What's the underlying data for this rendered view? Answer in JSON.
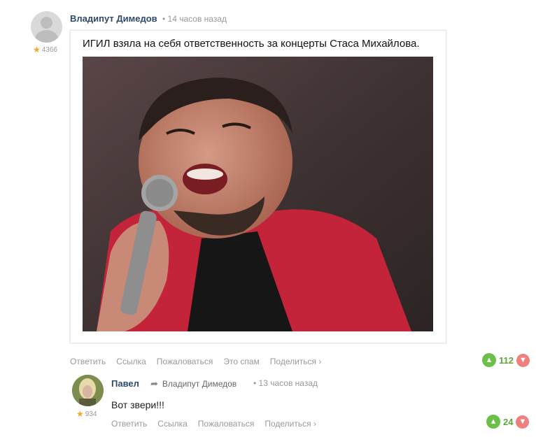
{
  "post": {
    "author": "Владипут Димедов",
    "time": "• 14 часов назад",
    "rating": "4366",
    "caption": "ИГИЛ взяла на себя ответственность за концерты Стаса Михайлова.",
    "actions": [
      "Ответить",
      "Ссылка",
      "Пожаловаться",
      "Это спам",
      "Поделиться ›"
    ],
    "likes": "112"
  },
  "reply": {
    "author": "Павел",
    "reply_to": "Владипут Димедов",
    "time": "• 13 часов назад",
    "rating": "934",
    "text": "Вот звери!!!",
    "actions": [
      "Ответить",
      "Ссылка",
      "Пожаловаться",
      "Поделиться ›"
    ],
    "likes": "24"
  },
  "icons": {
    "star": "star-icon",
    "like": "thumb-up-icon",
    "dislike": "thumb-down-icon",
    "reply_arrow": "reply-arrow-icon"
  },
  "colors": {
    "author": "#2e4a6b",
    "like": "#6cc04a",
    "dislike": "#f08080",
    "star": "#f5a623"
  }
}
